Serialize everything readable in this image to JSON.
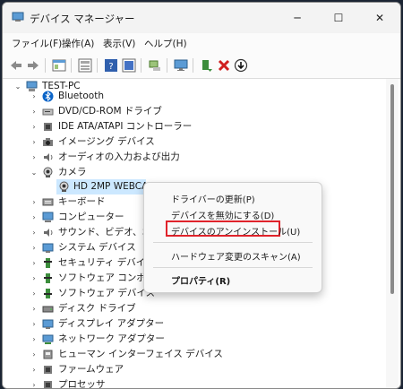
{
  "window": {
    "title": "デバイス マネージャー"
  },
  "window_controls": {
    "minimize": "─",
    "maximize": "☐",
    "close": "✕"
  },
  "menubar": [
    "ファイル(F)",
    "操作(A)",
    "表示(V)",
    "ヘルプ(H)"
  ],
  "toolbar": {
    "icons": [
      "back-icon",
      "forward-icon",
      "properties-pane-icon",
      "device-grid-icon",
      "help-icon",
      "device-info-icon",
      "scan-hardware-icon",
      "monitor-icon",
      "update-driver-icon",
      "uninstall-device-icon",
      "disable-device-icon"
    ]
  },
  "tree": {
    "root": "TEST-PC",
    "items": [
      {
        "label": "Bluetooth",
        "icon": "bluetooth-icon",
        "expanded": false
      },
      {
        "label": "DVD/CD-ROM ドライブ",
        "icon": "dvd-drive-icon",
        "expanded": false
      },
      {
        "label": "IDE ATA/ATAPI コントローラー",
        "icon": "ide-controller-icon",
        "expanded": false
      },
      {
        "label": "イメージング デバイス",
        "icon": "imaging-device-icon",
        "expanded": false
      },
      {
        "label": "オーディオの入力および出力",
        "icon": "audio-icon",
        "expanded": false
      },
      {
        "label": "カメラ",
        "icon": "camera-icon",
        "expanded": true
      },
      {
        "label": "HD 2MP WEBCAM",
        "icon": "webcam-icon",
        "child": true,
        "selected": true
      },
      {
        "label": "キーボード",
        "icon": "keyboard-icon",
        "expanded": false
      },
      {
        "label": "コンピューター",
        "icon": "computer-icon",
        "expanded": false
      },
      {
        "label": "サウンド、ビデオ、および",
        "icon": "sound-video-icon",
        "expanded": false
      },
      {
        "label": "システム デバイス",
        "icon": "system-device-icon",
        "expanded": false
      },
      {
        "label": "セキュリティ デバイス",
        "icon": "security-device-icon",
        "expanded": false
      },
      {
        "label": "ソフトウェア コンポーネン",
        "icon": "software-component-icon",
        "expanded": false
      },
      {
        "label": "ソフトウェア デバイス",
        "icon": "software-device-icon",
        "expanded": false
      },
      {
        "label": "ディスク ドライブ",
        "icon": "disk-drive-icon",
        "expanded": false
      },
      {
        "label": "ディスプレイ アダプター",
        "icon": "display-adapter-icon",
        "expanded": false
      },
      {
        "label": "ネットワーク アダプター",
        "icon": "network-adapter-icon",
        "expanded": false
      },
      {
        "label": "ヒューマン インターフェイス デバイス",
        "icon": "hid-icon",
        "expanded": false
      },
      {
        "label": "ファームウェア",
        "icon": "firmware-icon",
        "expanded": false
      },
      {
        "label": "プロセッサ",
        "icon": "processor-icon",
        "expanded": false
      }
    ]
  },
  "context_menu": {
    "items": [
      "ドライバーの更新(P)",
      "デバイスを無効にする(D)",
      "デバイスのアンインストール(U)",
      "ハードウェア変更のスキャン(A)",
      "プロパティ(R)"
    ],
    "highlighted_index": 2
  },
  "colors": {
    "highlight_box": "#e0232b",
    "selection": "#cce8ff",
    "accent": "#0067c0"
  }
}
